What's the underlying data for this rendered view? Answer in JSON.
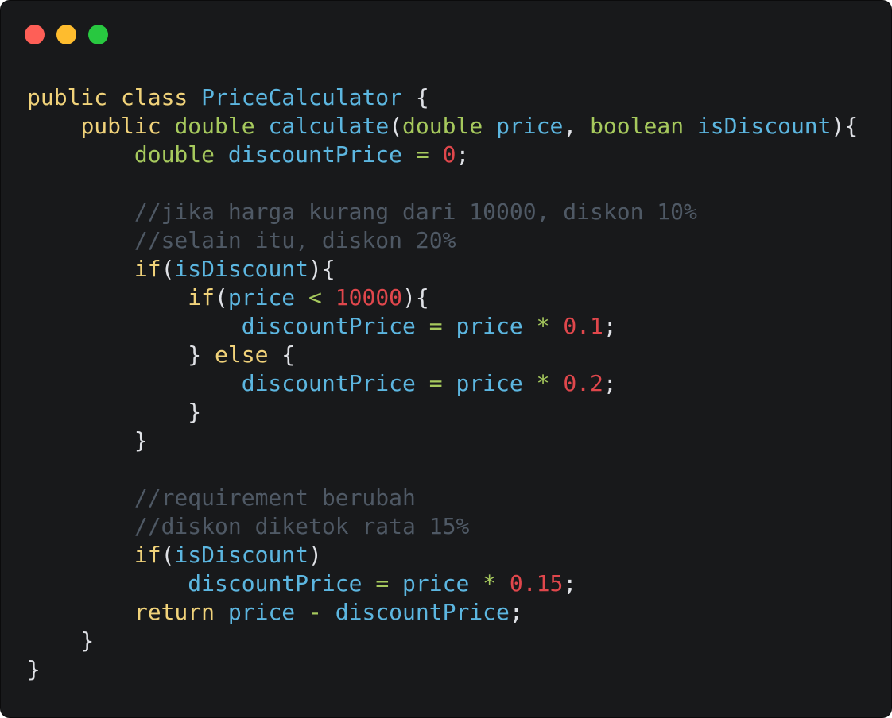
{
  "window": {
    "controls": [
      {
        "name": "close-button",
        "color": "#fe5f57"
      },
      {
        "name": "minimize-button",
        "color": "#febc2e"
      },
      {
        "name": "maximize-button",
        "color": "#28c840"
      }
    ]
  },
  "colors": {
    "background": "#18191b",
    "plain": "#dfe1e6",
    "keyword": "#f0d27a",
    "type": "#a6c95d",
    "identifier": "#5cb6e0",
    "number": "#e0474c",
    "comment": "#4f5965",
    "operator": "#a6c95d"
  },
  "code_lines": [
    [
      [
        "keyword",
        "public class "
      ],
      [
        "identifier",
        "PriceCalculator"
      ],
      [
        "plain",
        " {"
      ]
    ],
    [
      [
        "plain",
        "    "
      ],
      [
        "keyword",
        "public "
      ],
      [
        "type",
        "double "
      ],
      [
        "identifier",
        "calculate"
      ],
      [
        "plain",
        "("
      ],
      [
        "type",
        "double "
      ],
      [
        "identifier",
        "price"
      ],
      [
        "plain",
        ", "
      ],
      [
        "type",
        "boolean "
      ],
      [
        "identifier",
        "isDiscount"
      ],
      [
        "plain",
        "){"
      ]
    ],
    [
      [
        "plain",
        "        "
      ],
      [
        "type",
        "double "
      ],
      [
        "identifier",
        "discountPrice "
      ],
      [
        "operator",
        "= "
      ],
      [
        "number",
        "0"
      ],
      [
        "plain",
        ";"
      ]
    ],
    [],
    [
      [
        "plain",
        "        "
      ],
      [
        "comment",
        "//jika harga kurang dari 10000, diskon 10%"
      ]
    ],
    [
      [
        "plain",
        "        "
      ],
      [
        "comment",
        "//selain itu, diskon 20%"
      ]
    ],
    [
      [
        "plain",
        "        "
      ],
      [
        "keyword",
        "if"
      ],
      [
        "plain",
        "("
      ],
      [
        "identifier",
        "isDiscount"
      ],
      [
        "plain",
        "){"
      ]
    ],
    [
      [
        "plain",
        "            "
      ],
      [
        "keyword",
        "if"
      ],
      [
        "plain",
        "("
      ],
      [
        "identifier",
        "price "
      ],
      [
        "operator",
        "< "
      ],
      [
        "number",
        "10000"
      ],
      [
        "plain",
        "){"
      ]
    ],
    [
      [
        "plain",
        "                "
      ],
      [
        "identifier",
        "discountPrice "
      ],
      [
        "operator",
        "= "
      ],
      [
        "identifier",
        "price "
      ],
      [
        "operator",
        "* "
      ],
      [
        "number",
        "0.1"
      ],
      [
        "plain",
        ";"
      ]
    ],
    [
      [
        "plain",
        "            } "
      ],
      [
        "keyword",
        "else"
      ],
      [
        "plain",
        " {"
      ]
    ],
    [
      [
        "plain",
        "                "
      ],
      [
        "identifier",
        "discountPrice "
      ],
      [
        "operator",
        "= "
      ],
      [
        "identifier",
        "price "
      ],
      [
        "operator",
        "* "
      ],
      [
        "number",
        "0.2"
      ],
      [
        "plain",
        ";"
      ]
    ],
    [
      [
        "plain",
        "            }"
      ]
    ],
    [
      [
        "plain",
        "        }"
      ]
    ],
    [],
    [
      [
        "plain",
        "        "
      ],
      [
        "comment",
        "//requirement berubah"
      ]
    ],
    [
      [
        "plain",
        "        "
      ],
      [
        "comment",
        "//diskon diketok rata 15%"
      ]
    ],
    [
      [
        "plain",
        "        "
      ],
      [
        "keyword",
        "if"
      ],
      [
        "plain",
        "("
      ],
      [
        "identifier",
        "isDiscount"
      ],
      [
        "plain",
        ")"
      ]
    ],
    [
      [
        "plain",
        "            "
      ],
      [
        "identifier",
        "discountPrice "
      ],
      [
        "operator",
        "= "
      ],
      [
        "identifier",
        "price "
      ],
      [
        "operator",
        "* "
      ],
      [
        "number",
        "0.15"
      ],
      [
        "plain",
        ";"
      ]
    ],
    [
      [
        "plain",
        "        "
      ],
      [
        "keyword",
        "return "
      ],
      [
        "identifier",
        "price "
      ],
      [
        "operator",
        "- "
      ],
      [
        "identifier",
        "discountPrice"
      ],
      [
        "plain",
        ";"
      ]
    ],
    [
      [
        "plain",
        "    }"
      ]
    ],
    [
      [
        "plain",
        "}"
      ]
    ]
  ]
}
